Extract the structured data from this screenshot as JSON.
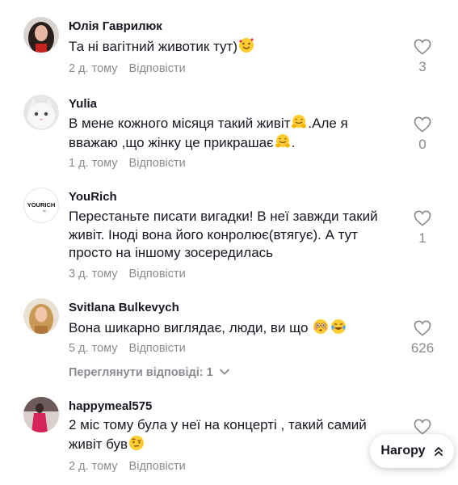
{
  "comments": [
    {
      "username": "Юлія Гаврилюк",
      "text_parts": [
        "Та ні вагітний животик тут)"
      ],
      "time": "2 д. тому",
      "reply_label": "Відповісти",
      "likes": "3",
      "emoji": [
        "smiling-face-with-hearts"
      ]
    },
    {
      "username": "Yulia",
      "text_parts": [
        "В мене кожного місяця такий живіт",
        ".Але я вважаю ,що жінку це прикрашає",
        "."
      ],
      "time": "1 д. тому",
      "reply_label": "Відповісти",
      "likes": "0",
      "emoji": [
        "hugging-face",
        "hugging-face"
      ]
    },
    {
      "username": "YouRich",
      "avatar_text": "YOURICH",
      "avatar_subtext": "by ...",
      "text_parts": [
        "Перестаньте писати вигадки! В неї завжди такий живіт. Іноді вона його конролює(втягує). А тут просто на іншому зосередилась"
      ],
      "time": "3 д. тому",
      "reply_label": "Відповісти",
      "likes": "1"
    },
    {
      "username": "Svitlana Bulkevych",
      "text_parts": [
        "Вона шикарно виглядає, люди, ви що "
      ],
      "time": "5 д. тому",
      "reply_label": "Відповісти",
      "likes": "626",
      "emoji": [
        "flushed-face",
        "tears-of-joy-face"
      ]
    },
    {
      "username": "happymeal575",
      "text_parts": [
        "2 міс тому була у неї на концерті , такий самий живіт був"
      ],
      "time": "2 д. тому",
      "reply_label": "Відповісти",
      "emoji": [
        "face-with-raised-eyebrow"
      ]
    }
  ],
  "view_replies": {
    "label": "Переглянути відповіді: 1",
    "icon": "chevron-down-icon"
  },
  "back_to_top": {
    "label": "Нагору",
    "icon": "double-chevron-up-icon"
  },
  "colors": {
    "text": "#161823",
    "secondary": "#8a8b91",
    "background": "#ffffff"
  }
}
